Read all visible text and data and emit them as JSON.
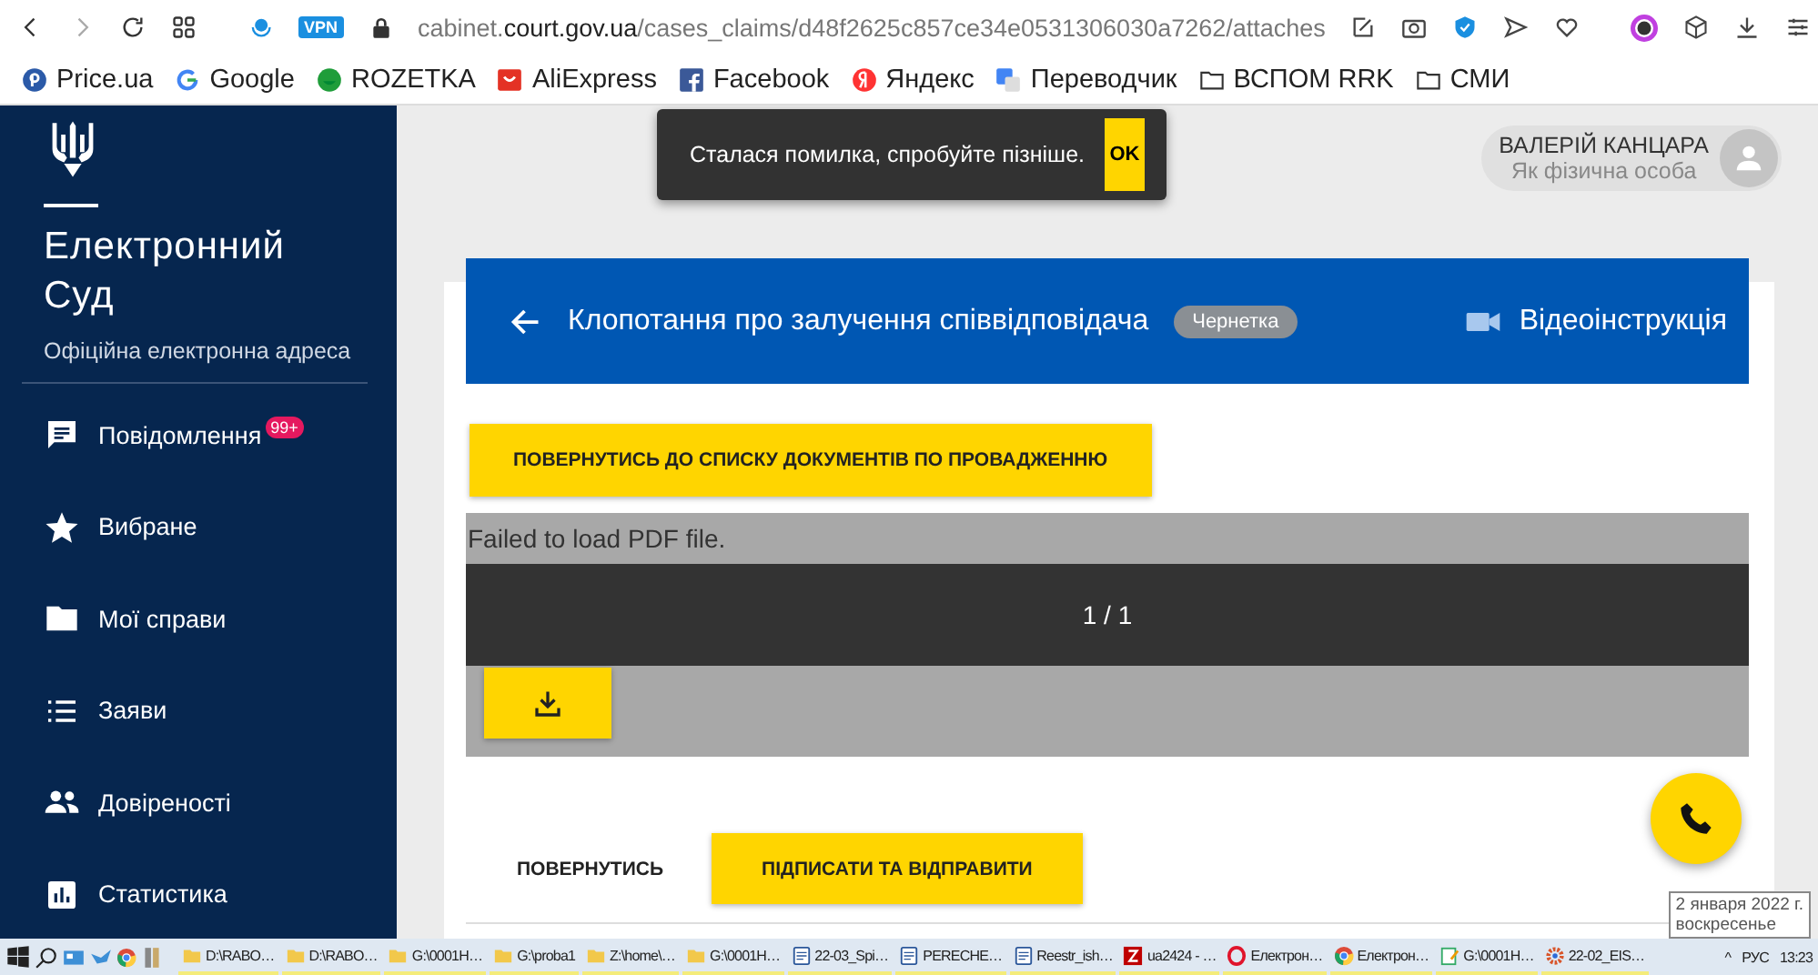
{
  "browser": {
    "vpn_badge": "VPN",
    "url": "cabinet.**court.gov.ua**/cases_claims/d48f2625c857ce34e0531306030a7262/attaches"
  },
  "bookmarks": [
    {
      "label": "Price.ua",
      "kind": "price"
    },
    {
      "label": "Google",
      "kind": "google"
    },
    {
      "label": "ROZETKA",
      "kind": "rozetka"
    },
    {
      "label": "AliExpress",
      "kind": "aliexpress"
    },
    {
      "label": "Facebook",
      "kind": "facebook"
    },
    {
      "label": "Яндекс",
      "kind": "yandex"
    },
    {
      "label": "Переводчик",
      "kind": "translate"
    },
    {
      "label": "ВСПОМ RRK",
      "kind": "folder"
    },
    {
      "label": "СМИ",
      "kind": "folder"
    }
  ],
  "sidebar": {
    "title": "Електронний Суд",
    "subtitle": "Офіційна електронна адреса",
    "items": [
      {
        "label": "Повідомлення",
        "kind": "chat",
        "badge": "99+"
      },
      {
        "label": "Вибране",
        "kind": "star"
      },
      {
        "label": "Мої справи",
        "kind": "folder"
      },
      {
        "label": "Заяви",
        "kind": "list"
      },
      {
        "label": "Довіреності",
        "kind": "people"
      },
      {
        "label": "Статистика",
        "kind": "chart"
      }
    ]
  },
  "toast": {
    "message": "Сталася помилка, спробуйте пізніше.",
    "button": "OK"
  },
  "user": {
    "name": "ВАЛЕРІЙ КАНЦАРА",
    "role": "Як фізична особа"
  },
  "document": {
    "title": "Клопотання про залучення співвідповідача",
    "status": "Чернетка",
    "video_link": "Відеоінструкція",
    "back_to_list_button": "ПОВЕРНУТИСЬ ДО СПИСКУ ДОКУМЕНТІВ ПО ПРОВАДЖЕННЮ",
    "pdf_viewer": {
      "error": "Failed to load PDF file.",
      "page_indicator": "1 / 1"
    },
    "buttons": [
      {
        "label": "ПОВЕРНУТИСЬ",
        "kind": "text"
      },
      {
        "label": "ПІДПИСАТИ ТА ВІДПРАВИТИ",
        "kind": "primary"
      }
    ]
  },
  "taskbar": {
    "items": [
      {
        "label": "D:\\RABO…",
        "kind": "folder"
      },
      {
        "label": "D:\\RABO…",
        "kind": "folder"
      },
      {
        "label": "G:\\0001H…",
        "kind": "folder"
      },
      {
        "label": "G:\\proba1",
        "kind": "folder"
      },
      {
        "label": "Z:\\home\\…",
        "kind": "folder"
      },
      {
        "label": "G:\\0001H…",
        "kind": "folder"
      },
      {
        "label": "22-03_Spi…",
        "kind": "word"
      },
      {
        "label": "PERECHE…",
        "kind": "word"
      },
      {
        "label": "Reestr_ish…",
        "kind": "word"
      },
      {
        "label": "ua2424 - …",
        "kind": "filezilla"
      },
      {
        "label": "Електрон…",
        "kind": "opera"
      },
      {
        "label": "Електрон…",
        "kind": "chrome"
      },
      {
        "label": "G:\\0001H…",
        "kind": "notepad"
      },
      {
        "label": "22-02_EIS…",
        "kind": "gear"
      }
    ],
    "tray_caret": "^",
    "language": "РУС",
    "time": "13:23",
    "date_tooltip": {
      "date": "2 января 2022 г.",
      "weekday": "воскресенье"
    }
  }
}
